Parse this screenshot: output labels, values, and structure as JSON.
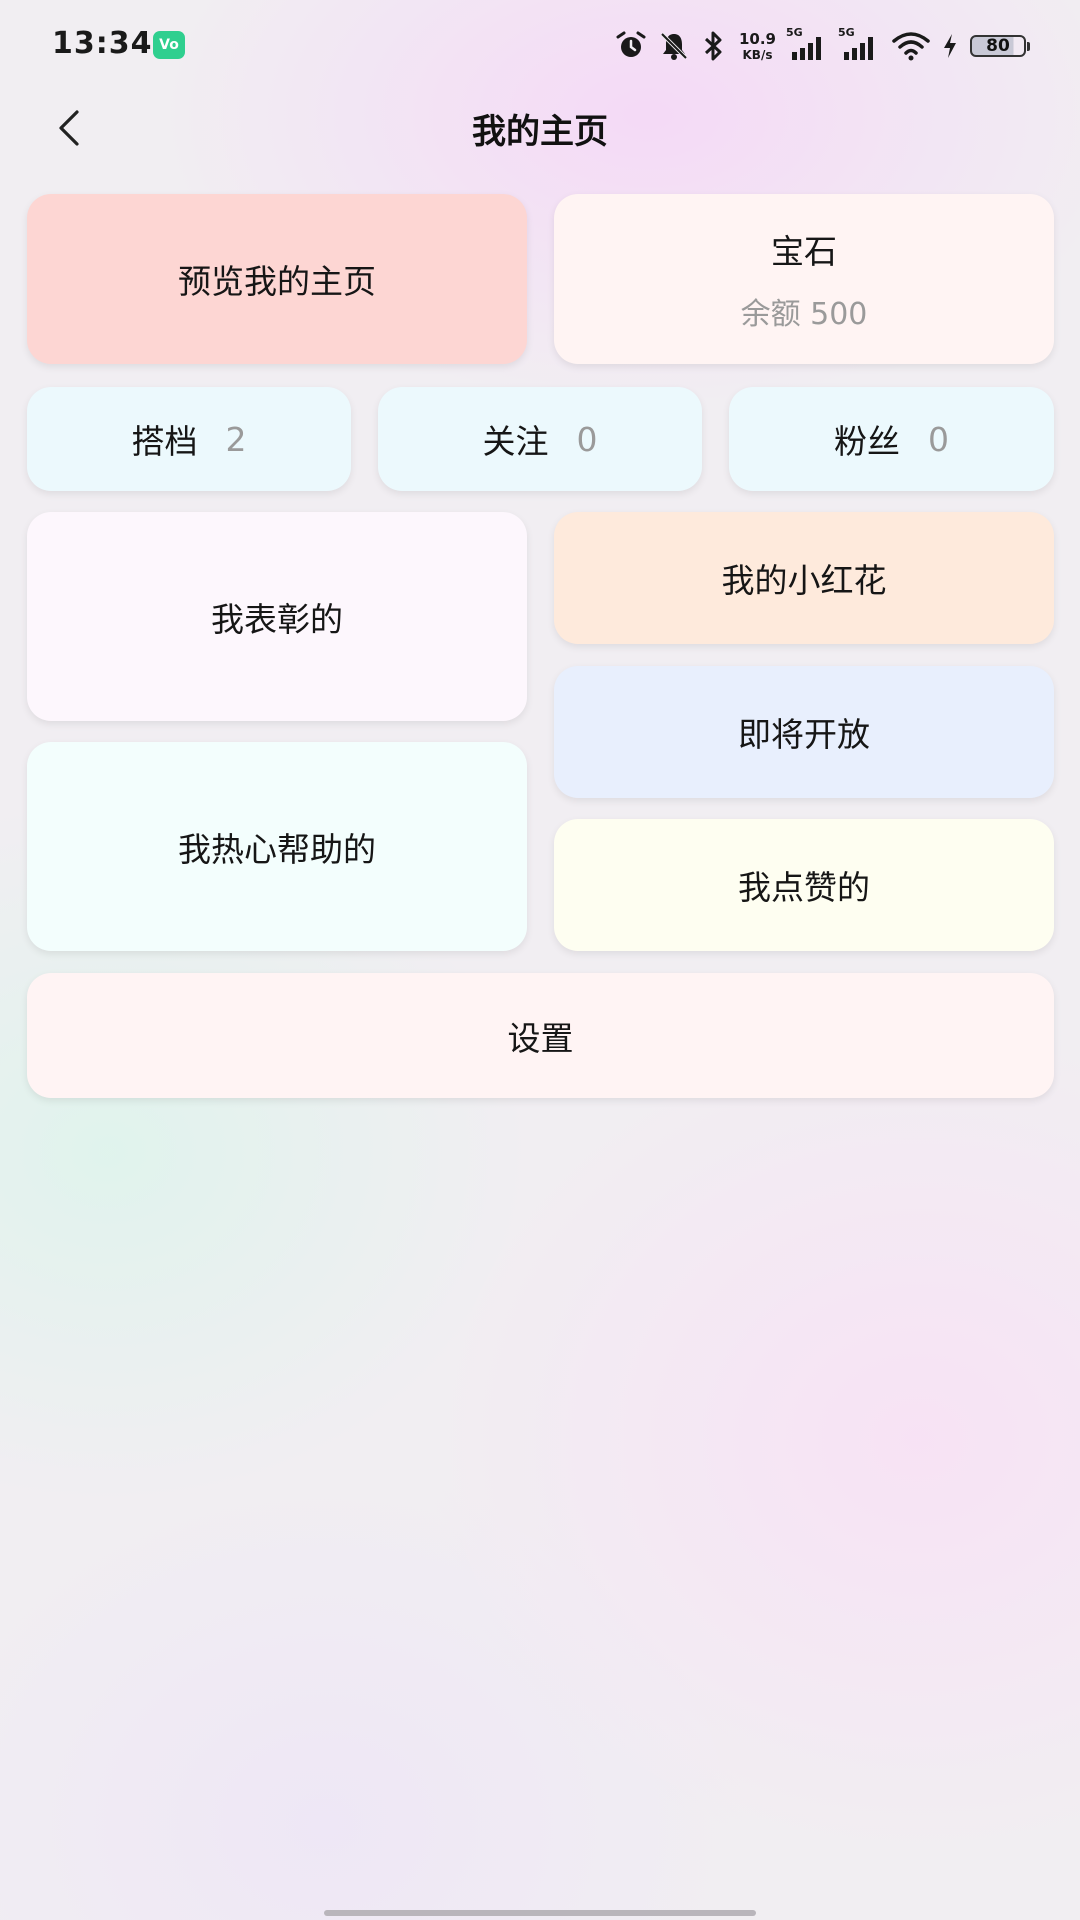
{
  "status_bar": {
    "time": "13:34",
    "app_badge": "Vo",
    "net_speed_value": "10.9",
    "net_speed_unit": "KB/s",
    "signal1_label": "5G",
    "signal2_label": "5G",
    "battery_level": "80",
    "icons": [
      "alarm-icon",
      "mute-bell-icon",
      "bluetooth-icon",
      "signal-icon",
      "wifi-icon",
      "charging-icon",
      "battery-icon"
    ]
  },
  "header": {
    "title": "我的主页",
    "back_icon": "chevron-left-icon"
  },
  "cards": {
    "preview": {
      "label": "预览我的主页",
      "color": "#fdd6d3"
    },
    "gems": {
      "label": "宝石",
      "balance": "余额 500",
      "color": "#fff4f3"
    },
    "partners": {
      "label": "搭档",
      "count": "2",
      "color": "#ecf9fd"
    },
    "following": {
      "label": "关注",
      "count": "0",
      "color": "#ecf9fd"
    },
    "fans": {
      "label": "粉丝",
      "count": "0",
      "color": "#ecf9fd"
    },
    "commended": {
      "label": "我表彰的",
      "color": "#fdf7fd"
    },
    "red_flower": {
      "label": "我的小红花",
      "color": "#feeadc"
    },
    "coming_soon": {
      "label": "即将开放",
      "color": "#e8effd"
    },
    "helped": {
      "label": "我热心帮助的",
      "color": "#f3fefd"
    },
    "liked": {
      "label": "我点赞的",
      "color": "#fefef1"
    },
    "settings": {
      "label": "设置",
      "color": "#fff4f4"
    }
  }
}
